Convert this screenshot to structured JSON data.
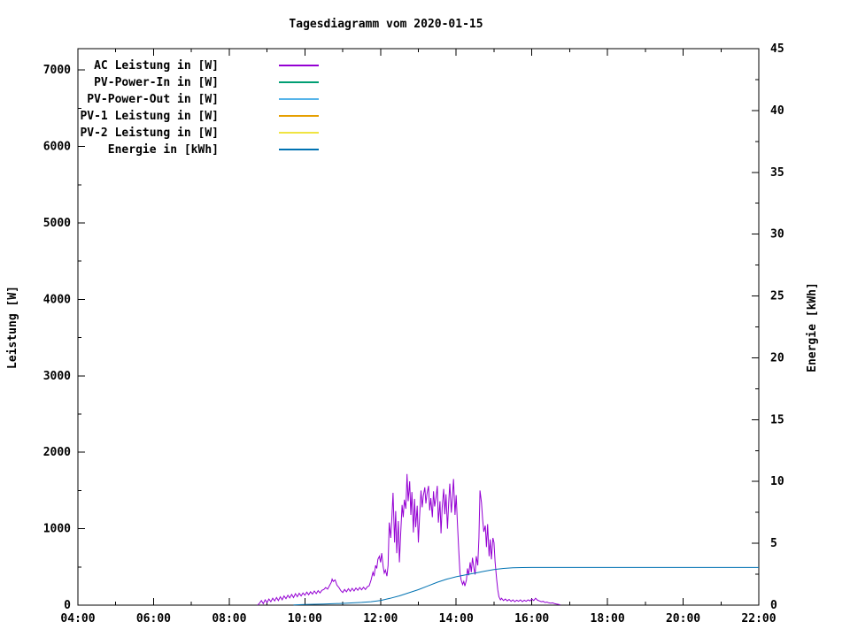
{
  "chart_data": {
    "type": "line",
    "title": "Tagesdiagramm vom 2020-01-15",
    "x_axis": {
      "range": [
        4,
        22
      ],
      "tick_hours": [
        4,
        6,
        8,
        10,
        12,
        14,
        16,
        18,
        20,
        22
      ],
      "tick_labels": [
        "04:00",
        "06:00",
        "08:00",
        "10:00",
        "12:00",
        "14:00",
        "16:00",
        "18:00",
        "20:00",
        "22:00"
      ],
      "minor_step": 1
    },
    "y_left": {
      "label": "Leistung [W]",
      "range": [
        0,
        7280
      ],
      "tick_values": [
        0,
        1000,
        2000,
        3000,
        4000,
        5000,
        6000,
        7000
      ],
      "tick_labels": [
        "0",
        "1000",
        "2000",
        "3000",
        "4000",
        "5000",
        "6000",
        "7000"
      ],
      "minor_step": 500
    },
    "y_right": {
      "label": "Energie [kWh]",
      "range": [
        0,
        45
      ],
      "tick_values": [
        0,
        5,
        10,
        15,
        20,
        25,
        30,
        35,
        40,
        45
      ],
      "tick_labels": [
        "0",
        "5",
        "10",
        "15",
        "20",
        "25",
        "30",
        "35",
        "40",
        "45"
      ],
      "minor_step": 2.5
    },
    "legend_position": "top-left-inside",
    "grid": false,
    "series": [
      {
        "name": "AC Leistung in [W]",
        "axis": "left",
        "color": "#9400d3",
        "points": [
          [
            8.75,
            0
          ],
          [
            8.8,
            25
          ],
          [
            8.85,
            60
          ],
          [
            8.9,
            20
          ],
          [
            8.95,
            70
          ],
          [
            9.0,
            35
          ],
          [
            9.05,
            80
          ],
          [
            9.1,
            45
          ],
          [
            9.15,
            90
          ],
          [
            9.2,
            55
          ],
          [
            9.25,
            100
          ],
          [
            9.3,
            60
          ],
          [
            9.35,
            110
          ],
          [
            9.4,
            70
          ],
          [
            9.45,
            120
          ],
          [
            9.5,
            85
          ],
          [
            9.55,
            130
          ],
          [
            9.6,
            95
          ],
          [
            9.65,
            140
          ],
          [
            9.7,
            100
          ],
          [
            9.75,
            150
          ],
          [
            9.8,
            110
          ],
          [
            9.85,
            155
          ],
          [
            9.9,
            120
          ],
          [
            9.95,
            160
          ],
          [
            10.0,
            130
          ],
          [
            10.05,
            170
          ],
          [
            10.1,
            135
          ],
          [
            10.15,
            175
          ],
          [
            10.2,
            145
          ],
          [
            10.25,
            185
          ],
          [
            10.3,
            150
          ],
          [
            10.35,
            190
          ],
          [
            10.4,
            160
          ],
          [
            10.45,
            195
          ],
          [
            10.5,
            205
          ],
          [
            10.55,
            230
          ],
          [
            10.6,
            210
          ],
          [
            10.65,
            255
          ],
          [
            10.7,
            300
          ],
          [
            10.72,
            340
          ],
          [
            10.75,
            310
          ],
          [
            10.8,
            330
          ],
          [
            10.85,
            260
          ],
          [
            10.9,
            230
          ],
          [
            10.95,
            190
          ],
          [
            11.0,
            165
          ],
          [
            11.05,
            205
          ],
          [
            11.1,
            175
          ],
          [
            11.15,
            215
          ],
          [
            11.2,
            180
          ],
          [
            11.25,
            220
          ],
          [
            11.3,
            185
          ],
          [
            11.35,
            225
          ],
          [
            11.4,
            195
          ],
          [
            11.45,
            230
          ],
          [
            11.5,
            200
          ],
          [
            11.55,
            235
          ],
          [
            11.6,
            205
          ],
          [
            11.65,
            240
          ],
          [
            11.7,
            255
          ],
          [
            11.75,
            330
          ],
          [
            11.8,
            430
          ],
          [
            11.83,
            380
          ],
          [
            11.87,
            520
          ],
          [
            11.9,
            480
          ],
          [
            11.93,
            600
          ],
          [
            11.97,
            640
          ],
          [
            12.0,
            560
          ],
          [
            12.03,
            680
          ],
          [
            12.07,
            500
          ],
          [
            12.1,
            420
          ],
          [
            12.13,
            460
          ],
          [
            12.17,
            380
          ],
          [
            12.2,
            520
          ],
          [
            12.23,
            1080
          ],
          [
            12.27,
            880
          ],
          [
            12.3,
            1150
          ],
          [
            12.33,
            1470
          ],
          [
            12.37,
            820
          ],
          [
            12.4,
            1230
          ],
          [
            12.43,
            680
          ],
          [
            12.47,
            1100
          ],
          [
            12.5,
            560
          ],
          [
            12.53,
            900
          ],
          [
            12.57,
            1310
          ],
          [
            12.6,
            1150
          ],
          [
            12.63,
            1380
          ],
          [
            12.67,
            1260
          ],
          [
            12.7,
            1715
          ],
          [
            12.73,
            1360
          ],
          [
            12.77,
            1620
          ],
          [
            12.8,
            1180
          ],
          [
            12.83,
            1480
          ],
          [
            12.87,
            950
          ],
          [
            12.9,
            1390
          ],
          [
            12.93,
            1020
          ],
          [
            12.97,
            1300
          ],
          [
            13.0,
            820
          ],
          [
            13.03,
            1140
          ],
          [
            13.07,
            1500
          ],
          [
            13.1,
            1280
          ],
          [
            13.13,
            1430
          ],
          [
            13.17,
            1540
          ],
          [
            13.2,
            1330
          ],
          [
            13.23,
            1460
          ],
          [
            13.27,
            1560
          ],
          [
            13.3,
            1240
          ],
          [
            13.33,
            1400
          ],
          [
            13.37,
            1150
          ],
          [
            13.4,
            1490
          ],
          [
            13.43,
            1290
          ],
          [
            13.47,
            1420
          ],
          [
            13.5,
            1560
          ],
          [
            13.53,
            1080
          ],
          [
            13.57,
            1360
          ],
          [
            13.6,
            940
          ],
          [
            13.63,
            1280
          ],
          [
            13.67,
            1520
          ],
          [
            13.7,
            1190
          ],
          [
            13.73,
            1450
          ],
          [
            13.77,
            1000
          ],
          [
            13.8,
            1330
          ],
          [
            13.83,
            1590
          ],
          [
            13.87,
            1210
          ],
          [
            13.9,
            1420
          ],
          [
            13.93,
            1650
          ],
          [
            13.97,
            1180
          ],
          [
            14.0,
            1440
          ],
          [
            14.03,
            1100
          ],
          [
            14.07,
            700
          ],
          [
            14.1,
            420
          ],
          [
            14.13,
            330
          ],
          [
            14.17,
            270
          ],
          [
            14.2,
            310
          ],
          [
            14.23,
            250
          ],
          [
            14.27,
            330
          ],
          [
            14.3,
            480
          ],
          [
            14.33,
            390
          ],
          [
            14.37,
            560
          ],
          [
            14.4,
            430
          ],
          [
            14.43,
            620
          ],
          [
            14.47,
            480
          ],
          [
            14.5,
            400
          ],
          [
            14.53,
            640
          ],
          [
            14.57,
            520
          ],
          [
            14.6,
            880
          ],
          [
            14.63,
            1500
          ],
          [
            14.67,
            1340
          ],
          [
            14.7,
            1120
          ],
          [
            14.73,
            960
          ],
          [
            14.77,
            1040
          ],
          [
            14.8,
            760
          ],
          [
            14.83,
            1060
          ],
          [
            14.87,
            640
          ],
          [
            14.9,
            860
          ],
          [
            14.93,
            600
          ],
          [
            14.97,
            880
          ],
          [
            15.0,
            820
          ],
          [
            15.03,
            560
          ],
          [
            15.07,
            340
          ],
          [
            15.1,
            200
          ],
          [
            15.13,
            110
          ],
          [
            15.17,
            70
          ],
          [
            15.2,
            90
          ],
          [
            15.25,
            60
          ],
          [
            15.3,
            80
          ],
          [
            15.35,
            55
          ],
          [
            15.4,
            75
          ],
          [
            15.45,
            50
          ],
          [
            15.5,
            70
          ],
          [
            15.55,
            45
          ],
          [
            15.6,
            65
          ],
          [
            15.65,
            50
          ],
          [
            15.7,
            70
          ],
          [
            15.75,
            45
          ],
          [
            15.8,
            65
          ],
          [
            15.85,
            50
          ],
          [
            15.9,
            70
          ],
          [
            15.95,
            55
          ],
          [
            16.0,
            80
          ],
          [
            16.05,
            60
          ],
          [
            16.1,
            90
          ],
          [
            16.15,
            65
          ],
          [
            16.2,
            55
          ],
          [
            16.25,
            45
          ],
          [
            16.3,
            50
          ],
          [
            16.35,
            35
          ],
          [
            16.4,
            40
          ],
          [
            16.45,
            30
          ],
          [
            16.5,
            25
          ],
          [
            16.55,
            30
          ],
          [
            16.6,
            20
          ],
          [
            16.65,
            15
          ],
          [
            16.7,
            10
          ],
          [
            16.75,
            5
          ]
        ]
      },
      {
        "name": "PV-Power-In in [W]",
        "axis": "left",
        "color": "#009e73",
        "points": []
      },
      {
        "name": "PV-Power-Out in [W]",
        "axis": "left",
        "color": "#56b4e9",
        "points": []
      },
      {
        "name": "PV-1 Leistung in [W]",
        "axis": "left",
        "color": "#e69f00",
        "points": []
      },
      {
        "name": "PV-2 Leistung in [W]",
        "axis": "left",
        "color": "#f0e442",
        "points": []
      },
      {
        "name": "Energie in [kWh]",
        "axis": "right",
        "color": "#0072b2",
        "points": [
          [
            9.7,
            0.02
          ],
          [
            10.0,
            0.05
          ],
          [
            10.5,
            0.09
          ],
          [
            11.0,
            0.14
          ],
          [
            11.5,
            0.22
          ],
          [
            11.75,
            0.28
          ],
          [
            12.0,
            0.38
          ],
          [
            12.25,
            0.55
          ],
          [
            12.5,
            0.75
          ],
          [
            12.75,
            1.0
          ],
          [
            13.0,
            1.25
          ],
          [
            13.25,
            1.55
          ],
          [
            13.5,
            1.85
          ],
          [
            13.75,
            2.1
          ],
          [
            14.0,
            2.3
          ],
          [
            14.25,
            2.45
          ],
          [
            14.5,
            2.6
          ],
          [
            14.75,
            2.75
          ],
          [
            15.0,
            2.88
          ],
          [
            15.25,
            2.97
          ],
          [
            15.5,
            3.02
          ],
          [
            15.75,
            3.04
          ],
          [
            16.0,
            3.05
          ],
          [
            17.0,
            3.05
          ],
          [
            18.0,
            3.05
          ],
          [
            19.0,
            3.05
          ],
          [
            20.0,
            3.05
          ],
          [
            21.0,
            3.05
          ],
          [
            22.0,
            3.05
          ]
        ]
      }
    ]
  }
}
